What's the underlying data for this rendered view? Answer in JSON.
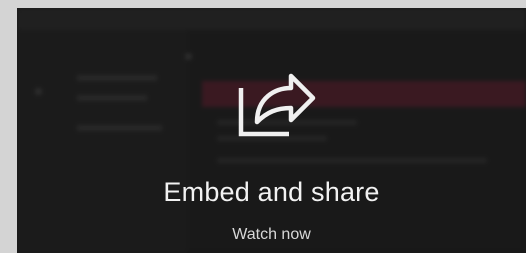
{
  "promo": {
    "icon": "share-icon",
    "title": "Embed and share",
    "cta_label": "Watch now"
  },
  "colors": {
    "card_background": "#1c1c1c",
    "banner_accent": "#5a1e2d",
    "text": "#f2f2f2"
  }
}
